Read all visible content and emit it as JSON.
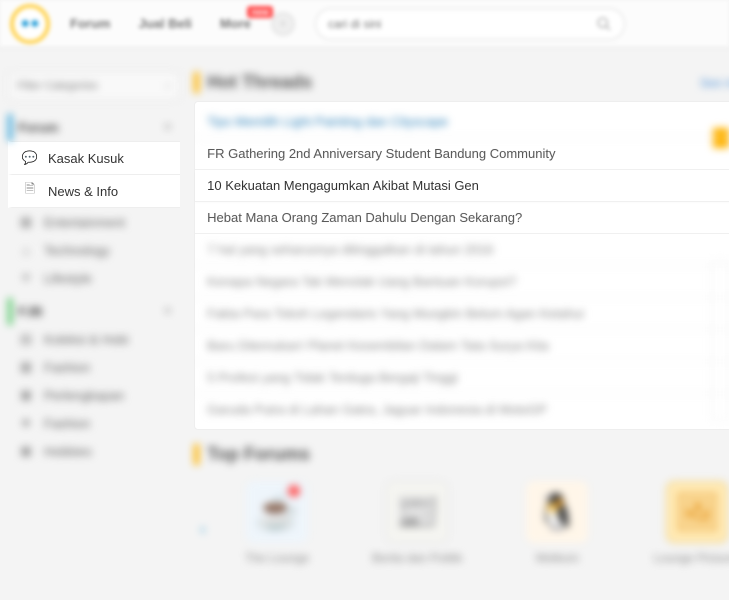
{
  "nav": {
    "logo_text": "●●",
    "links": [
      {
        "label": "Forum"
      },
      {
        "label": "Jual Beli"
      },
      {
        "label": "More",
        "badge": "new"
      }
    ],
    "search_placeholder": "cari di sini"
  },
  "sidebar": {
    "filter_placeholder": "Filter Categories",
    "groups": [
      {
        "accent": "blue",
        "header": "Forum",
        "items": [
          {
            "icon": "chat",
            "label": "Kasak Kusuk",
            "focus": true
          },
          {
            "icon": "news",
            "label": "News & Info",
            "focus": true
          },
          {
            "icon": "film",
            "label": "Entertainment"
          },
          {
            "icon": "chip",
            "label": "Technology"
          },
          {
            "icon": "life",
            "label": "Lifestyle"
          }
        ]
      },
      {
        "accent": "green",
        "header": "FJB",
        "items": [
          {
            "icon": "bag",
            "label": "Koleksi & Hobi"
          },
          {
            "icon": "grid",
            "label": "Fashion"
          },
          {
            "icon": "box",
            "label": "Perlengkapan"
          },
          {
            "icon": "star",
            "label": "Fashion"
          },
          {
            "icon": "cam",
            "label": "Hobbies"
          }
        ]
      }
    ]
  },
  "hot_threads": {
    "title": "Hot Threads",
    "more": "See more",
    "items": [
      {
        "label": "Tips Memilih Light Painting dan Cityscape",
        "link": true
      },
      {
        "label": "FR Gathering 2nd Anniversary Student Bandung Community"
      },
      {
        "label": "10 Kekuatan Mengagumkan Akibat Mutasi Gen",
        "active": true
      },
      {
        "label": "Hebat Mana Orang Zaman Dahulu Dengan Sekarang?"
      },
      {
        "label": "7 hal yang seharusnya ditinggalkan di tahun 2016"
      },
      {
        "label": "Kenapa Negara Tak Menolak Uang Bantuan Korupsi?"
      },
      {
        "label": "Fakta Para Tokoh Legendaris Yang Mungkin Belum Agan Ketahui"
      },
      {
        "label": "Baru Ditemukan! Planet Kesembilan Dalam Tata Surya Kita"
      },
      {
        "label": "5 Profesi yang Tidak Terduga Bergaji Tinggi"
      },
      {
        "label": "Garuda Putra di Lahan Gatra, Jaguar Indonesia di MotoGP"
      }
    ]
  },
  "top_forums": {
    "title": "Top Forums",
    "items": [
      {
        "emoji": "☕",
        "label": "The Lounge",
        "cls": "tf-1"
      },
      {
        "emoji": "📰",
        "label": "Berita dan Politik",
        "cls": "tf-2"
      },
      {
        "emoji": "🐧",
        "label": "Welkom",
        "cls": "tf-3"
      },
      {
        "emoji": "🖼",
        "label": "Lounge Pictures",
        "cls": "tf-4"
      }
    ]
  }
}
